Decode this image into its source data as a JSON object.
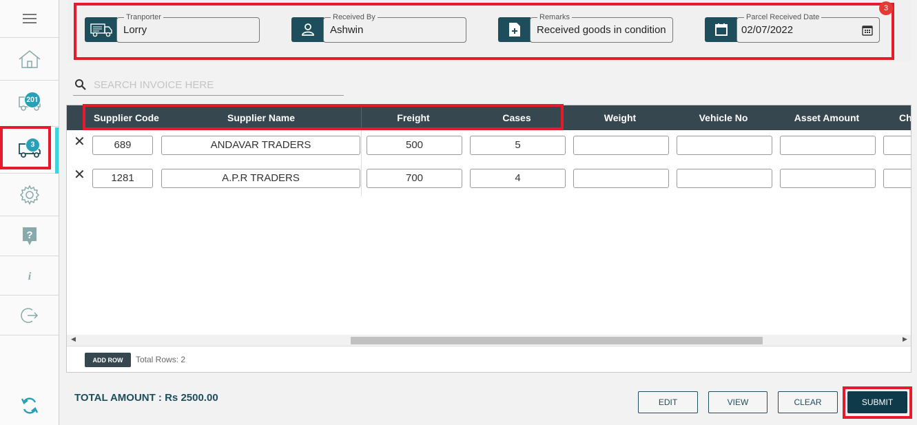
{
  "sidebar": {
    "menu_icon": "hamburger-icon",
    "items": [
      {
        "name": "home",
        "icon": "home-icon"
      },
      {
        "name": "delivery",
        "icon": "truck-icon",
        "badge": "201"
      },
      {
        "name": "parcel-received",
        "icon": "truck-icon",
        "badge": "3"
      },
      {
        "name": "settings",
        "icon": "gear-icon"
      },
      {
        "name": "help",
        "icon": "question-icon"
      },
      {
        "name": "info",
        "icon": "info-icon"
      },
      {
        "name": "logout",
        "icon": "logout-icon"
      },
      {
        "name": "sync",
        "icon": "sync-icon"
      }
    ]
  },
  "header": {
    "notification_count": "3",
    "fields": [
      {
        "label": "Tranporter",
        "value": "Lorry",
        "icon": "truck-icon"
      },
      {
        "label": "Received By",
        "value": "Ashwin",
        "icon": "person-icon"
      },
      {
        "label": "Remarks",
        "value": "Received goods in condition",
        "icon": "file-add-icon"
      },
      {
        "label": "Parcel Received Date",
        "value": "02/07/2022",
        "icon": "calendar-icon"
      }
    ]
  },
  "search": {
    "placeholder": "SEARCH INVOICE HERE",
    "value": ""
  },
  "grid": {
    "columns": [
      "Supplier Code",
      "Supplier Name",
      "Freight",
      "Cases",
      "Weight",
      "Vehicle No",
      "Asset Amount",
      "Ch"
    ],
    "rows": [
      [
        "689",
        "ANDAVAR TRADERS",
        "500",
        "5",
        "",
        "",
        "",
        ""
      ],
      [
        "1281",
        "A.P.R TRADERS",
        "700",
        "4",
        "",
        "",
        "",
        ""
      ]
    ],
    "add_row_label": "ADD ROW",
    "total_rows_label": "Total Rows: 2"
  },
  "footer": {
    "total_label": "TOTAL AMOUNT : Rs 2500.00",
    "buttons": {
      "edit": "EDIT",
      "view": "VIEW",
      "clear": "CLEAR",
      "submit": "SUBMIT"
    }
  },
  "colors": {
    "primary": "#1e4d5b",
    "header_bg": "#37474f",
    "highlight": "#e31b2a",
    "accent": "#2a9fb8"
  }
}
